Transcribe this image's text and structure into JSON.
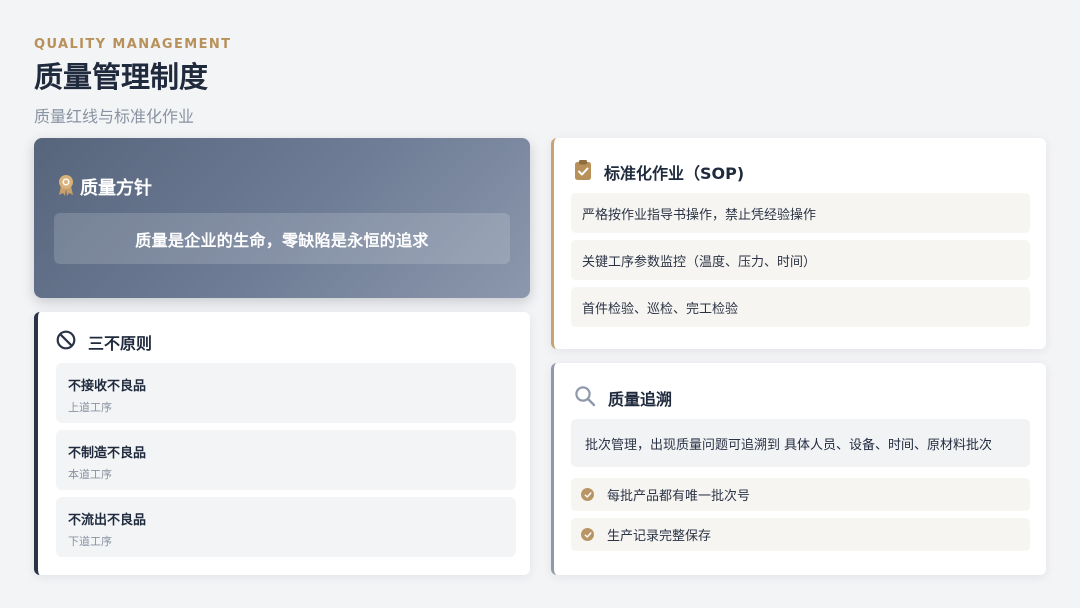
{
  "header": {
    "eyebrow": "QUALITY MANAGEMENT",
    "title": "质量管理制度",
    "subtitle": "质量红线与标准化作业"
  },
  "policy": {
    "title": "质量方针",
    "icon": "award-ribbon-icon",
    "quote": "质量是企业的生命，零缺陷是永恒的追求"
  },
  "three_no": {
    "title": "三不原则",
    "icon": "prohibited-icon",
    "items": [
      {
        "main": "不接收不良品",
        "sub": "上道工序"
      },
      {
        "main": "不制造不良品",
        "sub": "本道工序"
      },
      {
        "main": "不流出不良品",
        "sub": "下道工序"
      }
    ]
  },
  "sop": {
    "title": "标准化作业（SOP)",
    "icon": "clipboard-check-icon",
    "items": [
      "严格按作业指导书操作，禁止凭经验操作",
      "关键工序参数监控（温度、压力、时间）",
      "首件检验、巡检、完工检验"
    ]
  },
  "trace": {
    "title": "质量追溯",
    "icon": "search-icon",
    "desc_prefix": "批次管理，出现质量问题可追溯到",
    "desc_highlight": "具体人员、设备、时间、原材料批次",
    "items": [
      "每批产品都有唯一批次号",
      "生产记录完整保存"
    ]
  },
  "colors": {
    "accent_gold": "#b8905a",
    "navy": "#2b3446",
    "background": "#f3f4f6"
  }
}
